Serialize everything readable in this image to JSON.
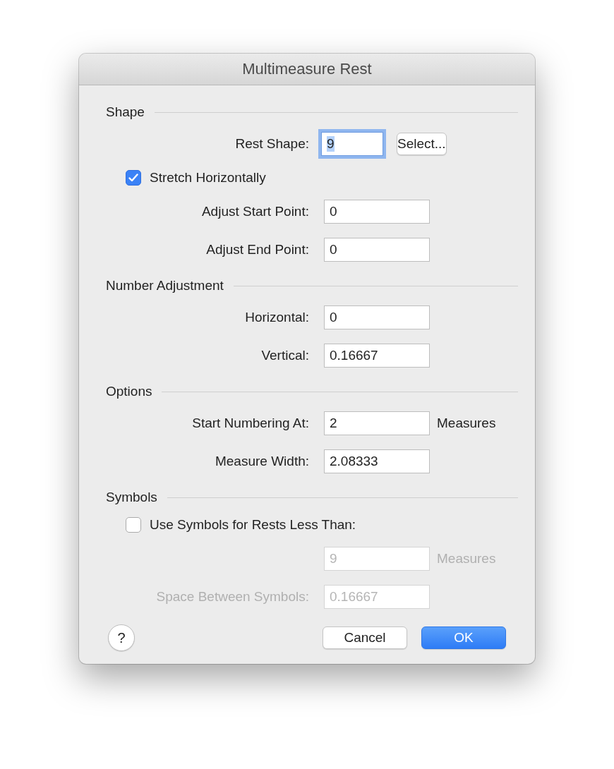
{
  "window": {
    "title": "Multimeasure Rest"
  },
  "sections": [
    {
      "title": "Shape",
      "rows": [
        {
          "kind": "field",
          "label": "Rest Shape:",
          "value": "9",
          "focused": true,
          "disabled": false,
          "button": "Select..."
        },
        {
          "kind": "checkbox",
          "label": "Stretch Horizontally",
          "checked": true
        },
        {
          "kind": "field",
          "label": "Adjust Start Point:",
          "value": "0",
          "focused": false,
          "disabled": false
        },
        {
          "kind": "field",
          "label": "Adjust End Point:",
          "value": "0",
          "focused": false,
          "disabled": false
        }
      ]
    },
    {
      "title": "Number Adjustment",
      "rows": [
        {
          "kind": "field",
          "label": "Horizontal:",
          "value": "0",
          "focused": false,
          "disabled": false
        },
        {
          "kind": "field",
          "label": "Vertical:",
          "value": "0.16667",
          "focused": false,
          "disabled": false
        }
      ]
    },
    {
      "title": "Options",
      "rows": [
        {
          "kind": "field",
          "label": "Start Numbering At:",
          "value": "2",
          "focused": false,
          "disabled": false,
          "unit": "Measures"
        },
        {
          "kind": "field",
          "label": "Measure Width:",
          "value": "2.08333",
          "focused": false,
          "disabled": false
        }
      ]
    },
    {
      "title": "Symbols",
      "rows": [
        {
          "kind": "checkbox",
          "label": "Use Symbols for Rests Less Than:",
          "checked": false
        },
        {
          "kind": "field",
          "value": "9",
          "focused": false,
          "disabled": true,
          "unit": "Measures"
        },
        {
          "kind": "field",
          "label": "Space Between Symbols:",
          "value": "0.16667",
          "focused": false,
          "disabled": true
        }
      ]
    }
  ],
  "buttons": [
    {
      "label": "Cancel",
      "default": false
    },
    {
      "label": "OK",
      "default": true
    }
  ],
  "help": "?"
}
